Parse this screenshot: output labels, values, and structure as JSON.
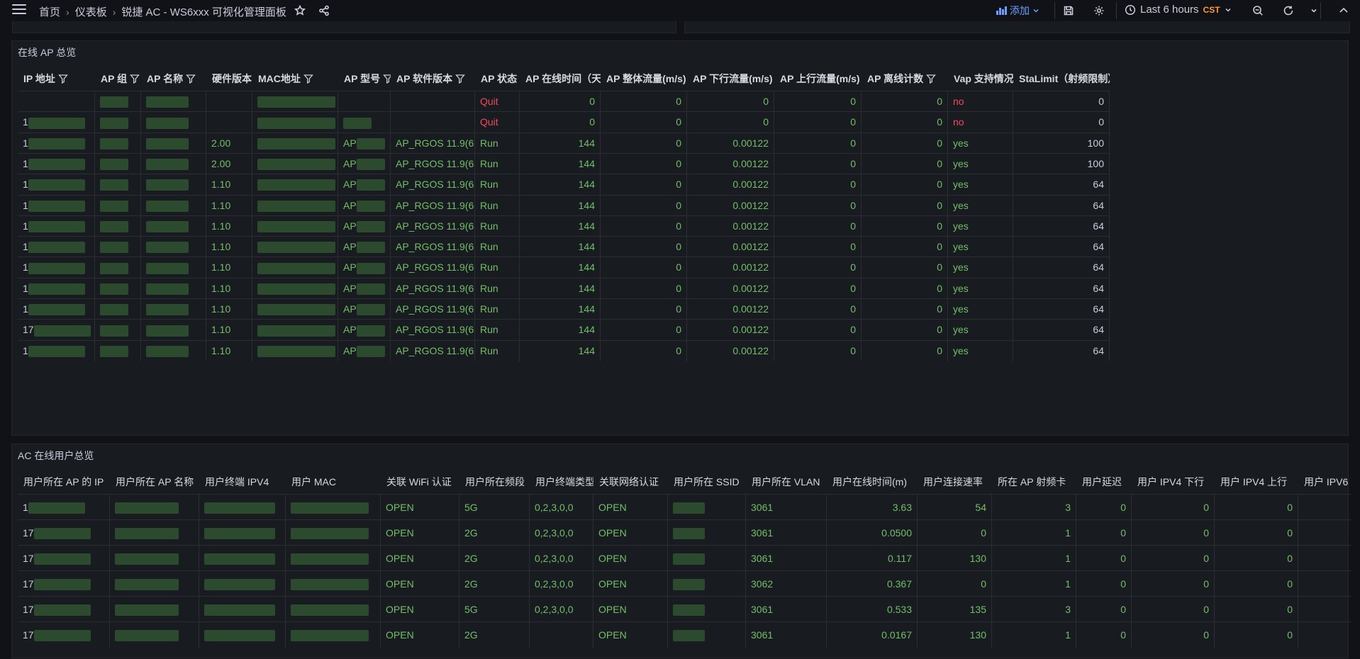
{
  "header": {
    "breadcrumb": [
      "首页",
      "仪表板",
      "锐捷 AC - WS6xxx 可视化管理面板"
    ],
    "add_label": "添加",
    "time_range": "Last 6 hours",
    "timezone": "CST"
  },
  "ap_panel": {
    "title": "在线 AP 总览",
    "columns": [
      "IP 地址",
      "AP 组",
      "AP 名称",
      "硬件版本",
      "MAC地址",
      "AP 型号",
      "AP 软件版本",
      "AP 状态",
      "AP 在线时间（天）",
      "AP 整体流量(m/s)",
      "AP 下行流量(m/s)",
      "AP 上行流量(m/s)",
      "AP 离线计数",
      "Vap 支持情况",
      "StaLimit（射频限制）"
    ],
    "rows": [
      {
        "ip": "",
        "hw": "",
        "model": "",
        "sw": "",
        "status": "Quit",
        "uptime": "0",
        "total": "0",
        "down": "0",
        "up": "0",
        "offline": "0",
        "vap": "no",
        "stalimit": "0"
      },
      {
        "ip": "1",
        "hw": "",
        "model": "",
        "sw": "",
        "status": "Quit",
        "uptime": "0",
        "total": "0",
        "down": "0",
        "up": "0",
        "offline": "0",
        "vap": "no",
        "stalimit": "0"
      },
      {
        "ip": "1",
        "hw": "2.00",
        "model": "AP",
        "sw": "AP_RGOS 11.9(6...",
        "status": "Run",
        "uptime": "144",
        "total": "0",
        "down": "0.00122",
        "up": "0",
        "offline": "0",
        "vap": "yes",
        "stalimit": "100"
      },
      {
        "ip": "1",
        "hw": "2.00",
        "model": "AP",
        "sw": "AP_RGOS 11.9(6...",
        "status": "Run",
        "uptime": "144",
        "total": "0",
        "down": "0.00122",
        "up": "0",
        "offline": "0",
        "vap": "yes",
        "stalimit": "100"
      },
      {
        "ip": "1",
        "hw": "1.10",
        "model": "AP",
        "sw": "AP_RGOS 11.9(6...",
        "status": "Run",
        "uptime": "144",
        "total": "0",
        "down": "0.00122",
        "up": "0",
        "offline": "0",
        "vap": "yes",
        "stalimit": "64"
      },
      {
        "ip": "1",
        "hw": "1.10",
        "model": "AP",
        "sw": "AP_RGOS 11.9(6...",
        "status": "Run",
        "uptime": "144",
        "total": "0",
        "down": "0.00122",
        "up": "0",
        "offline": "0",
        "vap": "yes",
        "stalimit": "64"
      },
      {
        "ip": "1",
        "hw": "1.10",
        "model": "AP",
        "sw": "AP_RGOS 11.9(6...",
        "status": "Run",
        "uptime": "144",
        "total": "0",
        "down": "0.00122",
        "up": "0",
        "offline": "0",
        "vap": "yes",
        "stalimit": "64"
      },
      {
        "ip": "1",
        "hw": "1.10",
        "model": "AP",
        "sw": "AP_RGOS 11.9(6...",
        "status": "Run",
        "uptime": "144",
        "total": "0",
        "down": "0.00122",
        "up": "0",
        "offline": "0",
        "vap": "yes",
        "stalimit": "64"
      },
      {
        "ip": "1",
        "hw": "1.10",
        "model": "AP",
        "sw": "AP_RGOS 11.9(6...",
        "status": "Run",
        "uptime": "144",
        "total": "0",
        "down": "0.00122",
        "up": "0",
        "offline": "0",
        "vap": "yes",
        "stalimit": "64"
      },
      {
        "ip": "1",
        "hw": "1.10",
        "model": "AP",
        "sw": "AP_RGOS 11.9(6...",
        "status": "Run",
        "uptime": "144",
        "total": "0",
        "down": "0.00122",
        "up": "0",
        "offline": "0",
        "vap": "yes",
        "stalimit": "64"
      },
      {
        "ip": "1",
        "hw": "1.10",
        "model": "AP",
        "sw": "AP_RGOS 11.9(6...",
        "status": "Run",
        "uptime": "144",
        "total": "0",
        "down": "0.00122",
        "up": "0",
        "offline": "0",
        "vap": "yes",
        "stalimit": "64"
      },
      {
        "ip": "17",
        "hw": "1.10",
        "model": "AP",
        "sw": "AP_RGOS 11.9(6...",
        "status": "Run",
        "uptime": "144",
        "total": "0",
        "down": "0.00122",
        "up": "0",
        "offline": "0",
        "vap": "yes",
        "stalimit": "64"
      },
      {
        "ip": "1",
        "hw": "1.10",
        "model": "AP",
        "sw": "AP_RGOS 11.9(6...",
        "status": "Run",
        "uptime": "144",
        "total": "0",
        "down": "0.00122",
        "up": "0",
        "offline": "0",
        "vap": "yes",
        "stalimit": "64"
      }
    ]
  },
  "user_panel": {
    "title": "AC 在线用户总览",
    "columns": [
      "用户所在 AP 的 IP",
      "用户所在 AP 名称",
      "用户终端 IPV4",
      "用户 MAC",
      "关联 WiFi 认证",
      "用户所在频段",
      "用户终端类型",
      "关联网络认证",
      "用户所在 SSID",
      "用户所在 VLAN",
      "用户在线时间(m)",
      "用户连接速率",
      "所在 AP 射频卡",
      "用户延迟",
      "用户 IPV4 下行",
      "用户 IPV4 上行",
      "用户 IPV6"
    ],
    "rows": [
      {
        "ip": "1",
        "wifi": "OPEN",
        "band": "5G",
        "type": "0,2,3,0,0",
        "net": "OPEN",
        "vlan": "3061",
        "online": "3.63",
        "rate": "54",
        "radio": "3",
        "delay": "0",
        "down": "0",
        "up": "0"
      },
      {
        "ip": "17",
        "wifi": "OPEN",
        "band": "2G",
        "type": "0,2,3,0,0",
        "net": "OPEN",
        "vlan": "3061",
        "online": "0.0500",
        "rate": "0",
        "radio": "1",
        "delay": "0",
        "down": "0",
        "up": "0"
      },
      {
        "ip": "17",
        "wifi": "OPEN",
        "band": "2G",
        "type": "0,2,3,0,0",
        "net": "OPEN",
        "vlan": "3061",
        "online": "0.117",
        "rate": "130",
        "radio": "1",
        "delay": "0",
        "down": "0",
        "up": "0"
      },
      {
        "ip": "17",
        "wifi": "OPEN",
        "band": "2G",
        "type": "0,2,3,0,0",
        "net": "OPEN",
        "vlan": "3062",
        "online": "0.367",
        "rate": "0",
        "radio": "1",
        "delay": "0",
        "down": "0",
        "up": "0"
      },
      {
        "ip": "17",
        "wifi": "OPEN",
        "band": "5G",
        "type": "0,2,3,0,0",
        "net": "OPEN",
        "vlan": "3061",
        "online": "0.533",
        "rate": "135",
        "radio": "3",
        "delay": "0",
        "down": "0",
        "up": "0"
      },
      {
        "ip": "17",
        "wifi": "OPEN",
        "band": "2G",
        "type": "",
        "net": "OPEN",
        "vlan": "3061",
        "online": "0.0167",
        "rate": "130",
        "radio": "1",
        "delay": "0",
        "down": "0",
        "up": "0"
      }
    ]
  },
  "colors": {
    "green": "#73bf69",
    "red": "#f2495c",
    "accent": "#6e9fff",
    "tz": "#ff9830"
  }
}
